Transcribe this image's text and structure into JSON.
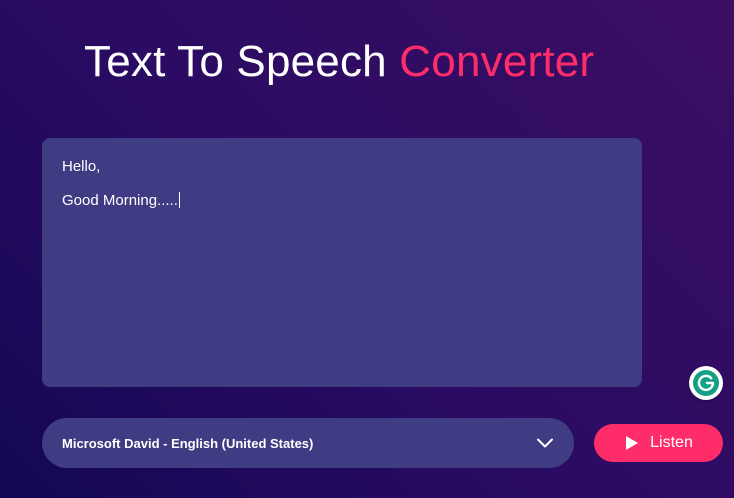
{
  "header": {
    "title_main": "Text To Speech",
    "title_accent": "Converter"
  },
  "text_input": {
    "lines": [
      "Hello,",
      "Good Morning....."
    ]
  },
  "voice_select": {
    "selected": "Microsoft David - English (United States)",
    "icon": "chevron-down-icon"
  },
  "listen_button": {
    "label": "Listen",
    "icon": "play-icon"
  },
  "grammarly": {
    "icon": "grammarly-icon"
  },
  "colors": {
    "accent": "#ff2c6a",
    "panel": "#3f3c83",
    "background_dark": "#130754",
    "background_light": "#3b0e63",
    "grammarly_green": "#15a085"
  }
}
